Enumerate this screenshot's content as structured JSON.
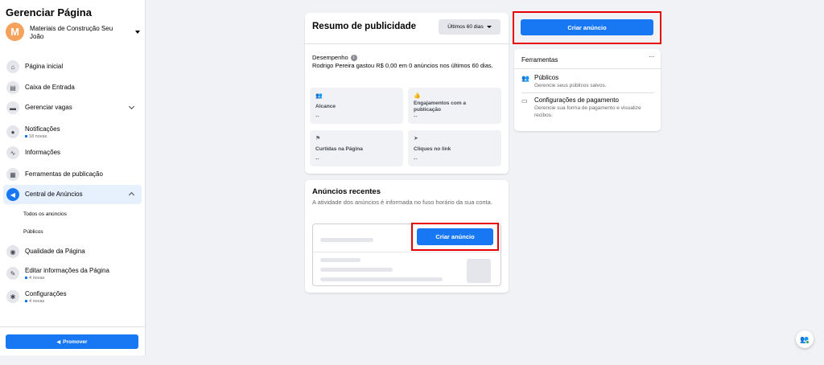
{
  "sidebar": {
    "title": "Gerenciar Página",
    "page": {
      "avatar_letter": "M",
      "name": "Materiais de Construção Seu João"
    },
    "items": [
      {
        "label": "Página inicial"
      },
      {
        "label": "Caixa de Entrada"
      },
      {
        "label": "Gerenciar vagas"
      },
      {
        "label": "Notificações",
        "badge": "18 novas"
      },
      {
        "label": "Informações"
      },
      {
        "label": "Ferramentas de publicação"
      },
      {
        "label": "Central de Anúncios"
      },
      {
        "label": "Qualidade da Página"
      },
      {
        "label": "Editar informações da Página",
        "badge": "4 novas"
      },
      {
        "label": "Configurações",
        "badge": "4 novas"
      }
    ],
    "subitems": [
      "Todos os anúncios",
      "Públicos"
    ],
    "promote_label": "Promover"
  },
  "summary": {
    "title": "Resumo de publicidade",
    "range": "Últimos 60 dias",
    "performance_label": "Desempenho",
    "performance_text": "Rodrigo Pereira gastou R$ 0,00 em 0 anúncios nos últimos 60 dias.",
    "metrics": [
      {
        "label": "Alcance",
        "value": "--"
      },
      {
        "label": "Engajamentos com a publicação",
        "value": "--"
      },
      {
        "label": "Curtidas na Página",
        "value": "--"
      },
      {
        "label": "Cliques no link",
        "value": "--"
      }
    ]
  },
  "recent": {
    "title": "Anúncios recentes",
    "subtitle": "A atividade dos anúncios é informada no fuso horário da sua conta.",
    "create_label": "Criar anúncio"
  },
  "top_create_label": "Criar anúncio",
  "tools": {
    "title": "Ferramentas",
    "items": [
      {
        "name": "Públicos",
        "desc": "Gerencie seus públicos salvos."
      },
      {
        "name": "Configurações de pagamento",
        "desc": "Gerencie sua forma de pagamento e visualize recibos."
      }
    ]
  },
  "colors": {
    "accent": "#1877f2",
    "highlight": "#e60000",
    "background": "#f0f2f5"
  }
}
